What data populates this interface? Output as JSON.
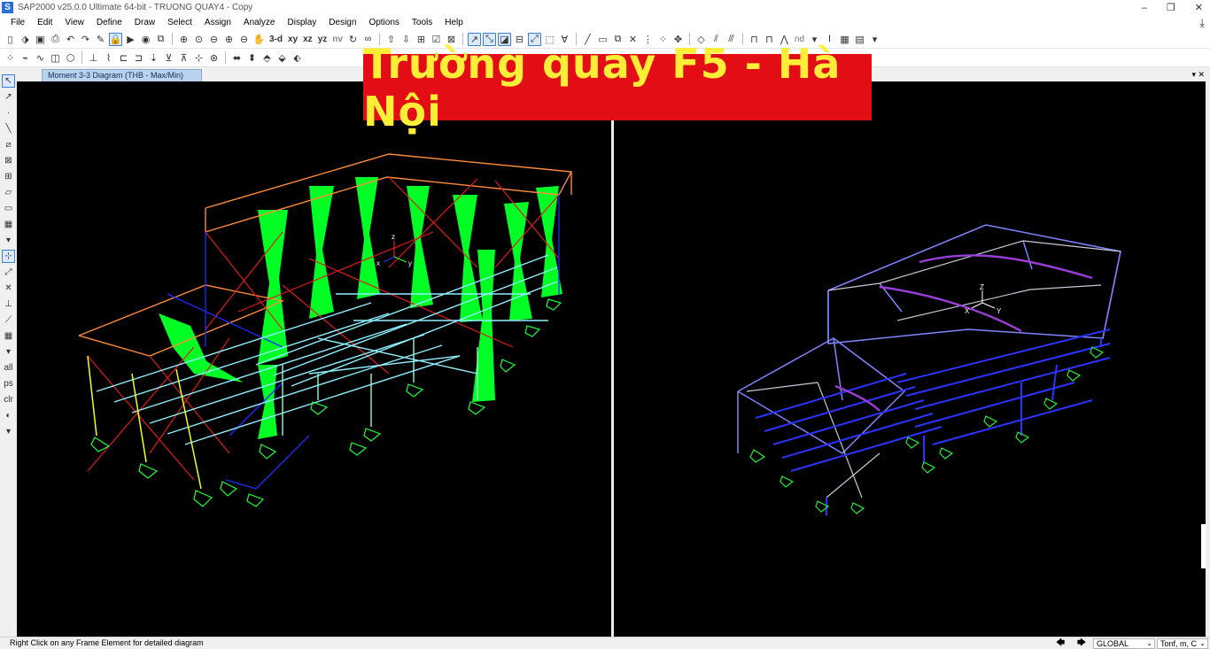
{
  "window": {
    "title": "SAP2000 v25.0.0 Ultimate 64-bit - TRUONG QUAY4 - Copy",
    "app_icon": "S",
    "minimize": "–",
    "restore": "❐",
    "close": "✕"
  },
  "menu": [
    "File",
    "Edit",
    "View",
    "Define",
    "Draw",
    "Select",
    "Assign",
    "Analyze",
    "Display",
    "Design",
    "Options",
    "Tools",
    "Help"
  ],
  "toolbar": {
    "view_3d": "3-d",
    "view_xy": "xy",
    "view_xz": "xz",
    "view_yz": "yz",
    "view_nv": "nv",
    "nd": "nd"
  },
  "tab": {
    "label": "Moment 3-3 Diagram (THB - Max/Min)",
    "close": "✕"
  },
  "banner": {
    "text": "Trường quay F5 - Hà Nội"
  },
  "left_view": {
    "axis_x": "x",
    "axis_y": "y",
    "axis_z": "z"
  },
  "right_view": {
    "axis_x": "X",
    "axis_y": "Y",
    "axis_z": "Z"
  },
  "status": {
    "message": "Right Click on any Frame Element for detailed diagram",
    "coord_system": "GLOBAL",
    "units": "Tonf, m, C"
  },
  "colors": {
    "viewport_bg": "#000000",
    "banner_bg": "#e30d16",
    "banner_text": "#ffee38",
    "moment_fill": "#00ff24",
    "tab_active": "#b9d2ee"
  }
}
